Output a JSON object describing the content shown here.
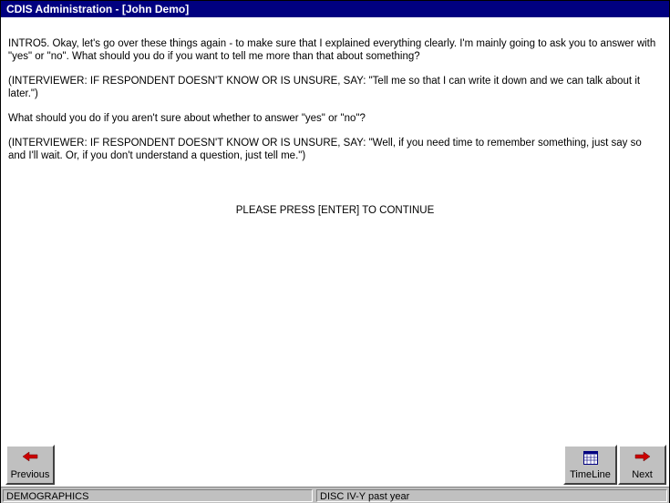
{
  "window": {
    "title": "CDIS Administration - [John Demo]"
  },
  "content": {
    "intro": "INTRO5. Okay, let's go over these things again - to make sure that I explained everything clearly. I'm mainly going to ask you to answer with \"yes\" or \"no\". What should you do if you want to tell me more than that about something?",
    "instruction1": "(INTERVIEWER: IF RESPONDENT DOESN'T KNOW OR IS UNSURE, SAY: \"Tell me so that I can write it down and we can talk about it later.\")",
    "question2": "What should you do if you aren't sure about whether to answer \"yes\" or \"no\"?",
    "instruction2": "(INTERVIEWER: IF RESPONDENT DOESN'T KNOW OR IS UNSURE, SAY: \"Well, if you need time to remember something, just say so and I'll wait. Or, if you don't understand a question, just tell me.\")",
    "continue_prompt": "PLEASE PRESS [ENTER] TO CONTINUE"
  },
  "buttons": {
    "previous": {
      "label": "Previous",
      "icon": "arrow-left-icon",
      "color": "#cc0000"
    },
    "timeline": {
      "label": "TimeLine",
      "icon": "calendar-icon"
    },
    "next": {
      "label": "Next",
      "icon": "arrow-right-icon",
      "color": "#cc0000"
    }
  },
  "status": {
    "section": "DEMOGRAPHICS",
    "module": "DISC IV-Y past year"
  }
}
